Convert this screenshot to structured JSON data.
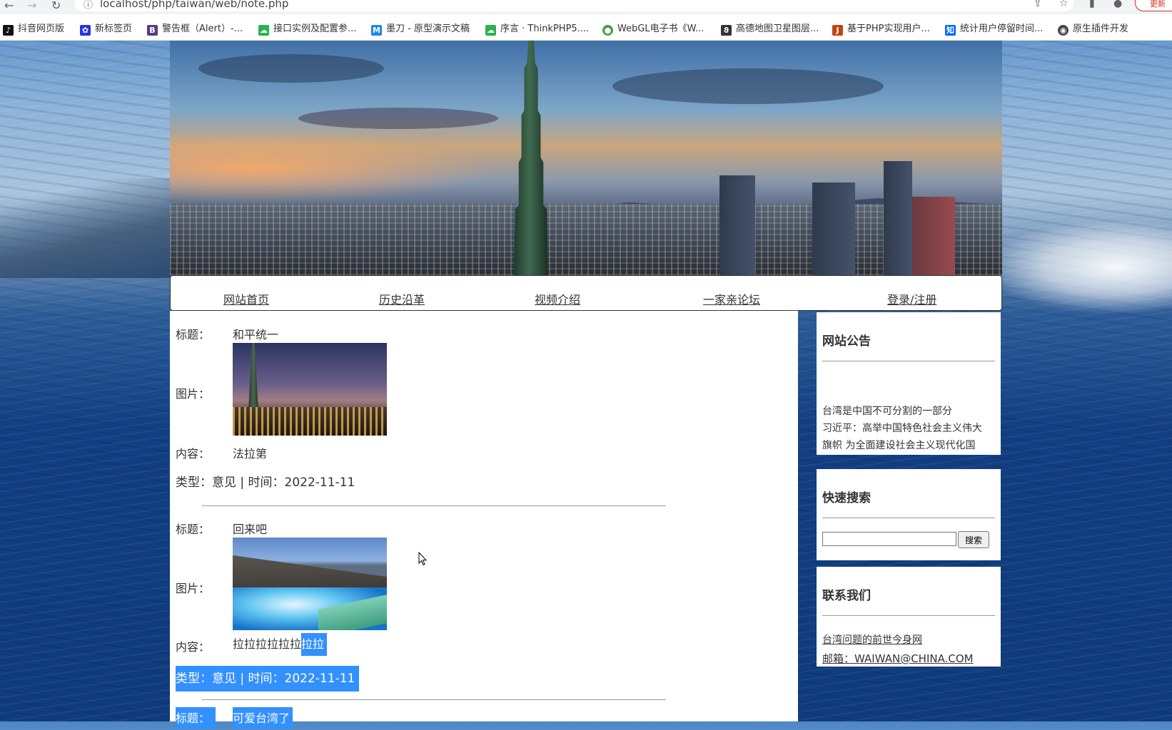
{
  "browser": {
    "url": "localhost/php/taiwan/web/note.php",
    "update_label": "更新",
    "bookmarks": [
      {
        "label": "抖音网页版",
        "icon": "tiktok-icon",
        "color": "#111111",
        "glyph": "♪"
      },
      {
        "label": "新标签页",
        "icon": "baidu-paw-icon",
        "color": "#2932e1",
        "glyph": "✿"
      },
      {
        "label": "警告框（Alert）-...",
        "icon": "bootstrap-icon",
        "color": "#563d7c",
        "glyph": "B"
      },
      {
        "label": "接口实例及配置参...",
        "icon": "cloud-icon",
        "color": "#2bb24c",
        "glyph": "☁"
      },
      {
        "label": "墨刀 - 原型演示文稿",
        "icon": "modao-icon",
        "color": "#1e88e5",
        "glyph": "M"
      },
      {
        "label": "序言 · ThinkPHP5....",
        "icon": "cloud-icon",
        "color": "#2bb24c",
        "glyph": "☁"
      },
      {
        "label": "WebGL电子书《W...",
        "icon": "globe-icon",
        "color": "#43a047",
        "glyph": "●"
      },
      {
        "label": "高德地图卫星图层...",
        "icon": "amap-icon",
        "color": "#333333",
        "glyph": "ϑ"
      },
      {
        "label": "基于PHP实现用户...",
        "icon": "csdn-icon",
        "color": "#c1440e",
        "glyph": "J"
      },
      {
        "label": "统计用户停留时间...",
        "icon": "zhihu-icon",
        "color": "#0066ff",
        "glyph": "知"
      },
      {
        "label": "原生插件开发",
        "icon": "plugin-icon",
        "color": "#444444",
        "glyph": "◉"
      }
    ]
  },
  "nav": {
    "items": [
      "网站首页",
      "历史沿革",
      "视频介绍",
      "一家亲论坛",
      "登录/注册"
    ]
  },
  "posts": [
    {
      "title_label": "标题：",
      "title": "和平统一",
      "image_label": "图片：",
      "image_icon": "taipei-101-night-photo",
      "content_label": "内容：",
      "content": "法拉第",
      "meta": "类型：意见 | 时间：2022-11-11"
    },
    {
      "title_label": "标题：",
      "title": "回来吧",
      "image_label": "图片：",
      "image_icon": "sea-wave-photo",
      "content_label": "内容：",
      "content_a": "拉拉拉拉拉拉",
      "content_b": "拉拉",
      "meta": "类型：意见 | 时间：2022-11-11"
    },
    {
      "title_label": "标题：",
      "title": "可爱台湾了"
    }
  ],
  "sidebar": {
    "notice": {
      "title": "网站公告",
      "lines": [
        "台湾是中国不可分割的一部分",
        "习近平：高举中国特色社会主义伟大",
        "旗帜 为全面建设社会主义现代化国"
      ]
    },
    "search": {
      "title": "快速搜索",
      "value": "",
      "button": "搜索"
    },
    "contact": {
      "title": "联系我们",
      "site": "台湾问题的前世今身网",
      "email": "邮箱：WAIWAN@CHINA.COM"
    }
  }
}
